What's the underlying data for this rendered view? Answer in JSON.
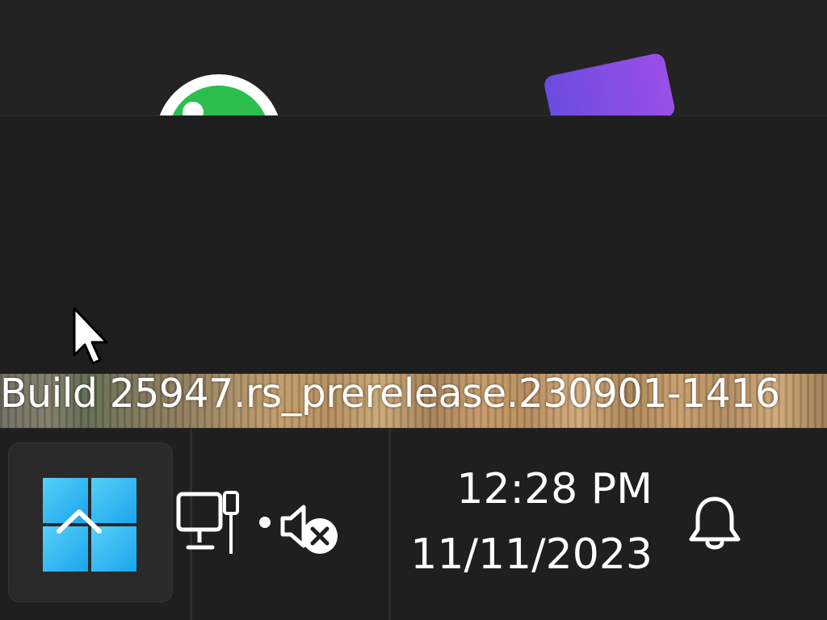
{
  "start_menu": {
    "pinned_apps": [
      {
        "icon": "whatsapp-icon"
      },
      {
        "icon": "app-purple-icon"
      }
    ]
  },
  "watermark": {
    "build_text": "Build 25947.rs_prerelease.230901-1416"
  },
  "taskbar": {
    "start_button": {
      "icon": "windows-logo-icon",
      "overlay_icon": "chevron-up-icon"
    },
    "system_tray": {
      "network_icon": "ethernet-network-icon",
      "volume_icon": "volume-muted-icon"
    },
    "clock": {
      "time": "12:28 PM",
      "date": "11/11/2023"
    },
    "notifications_icon": "bell-icon"
  },
  "colors": {
    "taskbar_bg": "#1f1f1f",
    "panel_bg": "#1e1e1e",
    "windows_blue": "#1aa5ec",
    "whatsapp_green": "#2bbf4e",
    "accent_purple": "#8a4ee4"
  }
}
